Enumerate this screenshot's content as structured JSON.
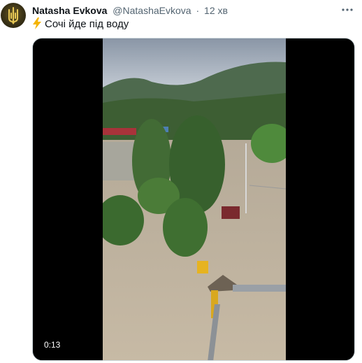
{
  "user": {
    "display_name": "Natasha Evkova",
    "handle": "@NatashaEvkova",
    "separator": "·",
    "time": "12 хв",
    "avatar_icon": "trident-emblem-icon"
  },
  "tweet": {
    "emoji_icon": "lightning-bolt-icon",
    "text": "Сочі йде під воду"
  },
  "media": {
    "type": "video",
    "timestamp": "0:13",
    "description_icon": "video-thumbnail"
  },
  "menu": {
    "icon": "more-options-icon"
  },
  "colors": {
    "text_primary": "#0f1419",
    "text_secondary": "#536471",
    "bolt": "#f4b400",
    "media_bg": "#000000"
  }
}
